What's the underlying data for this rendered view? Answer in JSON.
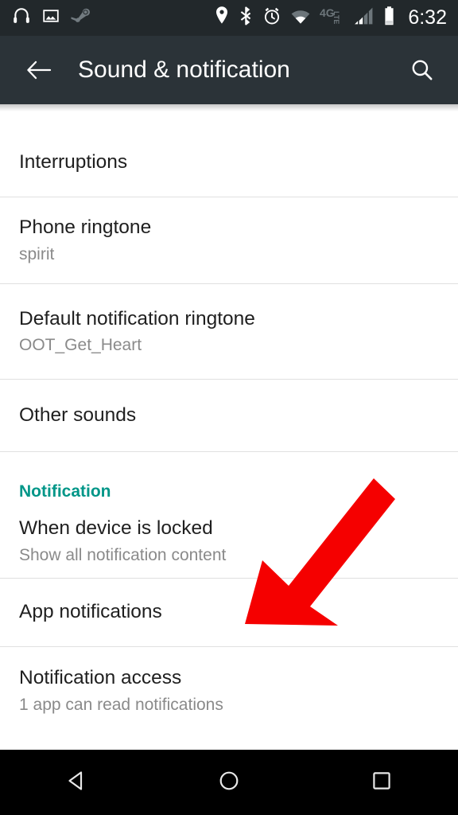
{
  "status_bar": {
    "left_icons": [
      {
        "name": "headphones-icon",
        "label": "Headphones"
      },
      {
        "name": "screenshot-image-icon",
        "label": "Screenshot"
      },
      {
        "name": "steam-icon",
        "label": "Steam"
      }
    ],
    "right_icons": [
      {
        "name": "location-icon",
        "label": "Location"
      },
      {
        "name": "bluetooth-icon",
        "label": "Bluetooth"
      },
      {
        "name": "alarm-icon",
        "label": "Alarm"
      },
      {
        "name": "wifi-icon",
        "label": "Wi-Fi"
      },
      {
        "name": "4g-lte-icon",
        "label": "4G LTE"
      },
      {
        "name": "signal-bars-icon",
        "label": "Cellular signal"
      },
      {
        "name": "battery-icon",
        "label": "Battery"
      }
    ],
    "network_type": "4G",
    "network_type_sub": "LTE",
    "clock": "6:32"
  },
  "action_bar": {
    "back_label": "Back",
    "title": "Sound & notification",
    "search_label": "Search"
  },
  "list": {
    "items": [
      {
        "name": "list-item-interruptions",
        "title": "Interruptions",
        "subtitle": ""
      },
      {
        "name": "list-item-phone-ringtone",
        "title": "Phone ringtone",
        "subtitle": "spirit"
      },
      {
        "name": "list-item-default-notification-ringtone",
        "title": "Default notification ringtone",
        "subtitle": "OOT_Get_Heart"
      },
      {
        "name": "list-item-other-sounds",
        "title": "Other sounds",
        "subtitle": ""
      },
      {
        "name": "list-item-when-device-is-locked",
        "title": "When device is locked",
        "subtitle": "Show all notification content"
      },
      {
        "name": "list-item-app-notifications",
        "title": "App notifications",
        "subtitle": ""
      },
      {
        "name": "list-item-notification-access",
        "title": "Notification access",
        "subtitle": "1 app can read notifications"
      }
    ],
    "section_header": "Notification"
  },
  "annotation": {
    "arrow_color": "#f50000",
    "arrow_points_to": "App notifications"
  },
  "nav_bar": {
    "back_label": "Back",
    "home_label": "Home",
    "recents_label": "Recent apps"
  },
  "colors": {
    "status_bar_bg": "#22282b",
    "action_bar_bg": "#2b3338",
    "accent_teal": "#009688",
    "toggle_teal": "#00897b",
    "primary_text": "#1f1f1f",
    "secondary_text": "#8a8a8a",
    "divider": "#e0e0e0",
    "nav_bar_bg": "#000000"
  }
}
